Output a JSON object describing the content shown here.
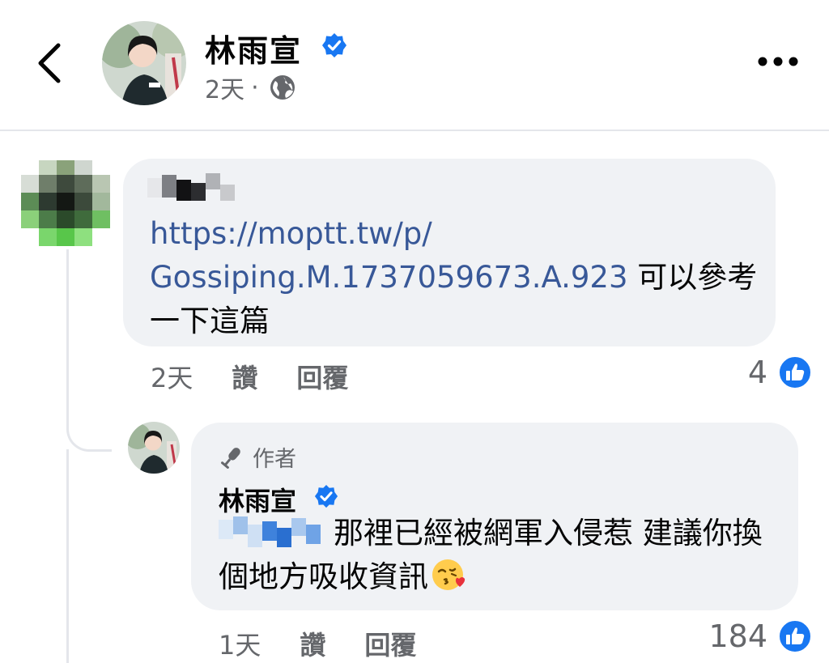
{
  "post_header": {
    "author_name": "林雨宣",
    "time": "2天",
    "separator": "·",
    "verified_icon": "verified-badge-icon",
    "audience_icon": "globe-icon",
    "back_icon": "back-chevron-icon",
    "more_icon": "more-dots-icon"
  },
  "comments": [
    {
      "author_name_blurred": true,
      "link_text_1": "https://moptt.tw/p/",
      "link_text_2": "Gossiping.M.1737059673.A.923",
      "text_after_link": " 可以參考一下這篇",
      "time": "2天",
      "like_label": "讚",
      "reply_label": "回覆",
      "like_count": "4"
    },
    {
      "author_badge": "作者",
      "author_name": "林雨宣",
      "mention_blurred": true,
      "text": "那裡已經被網軍入侵惹 建議你換個地方吸收資訊",
      "emoji": "kissing-heart-emoji",
      "time": "1天",
      "like_label": "讚",
      "reply_label": "回覆",
      "like_count": "184"
    }
  ],
  "colors": {
    "link": "#385898",
    "bubble": "#f0f2f5",
    "secondary_text": "#65676b",
    "facebook_blue": "#1877f2"
  }
}
